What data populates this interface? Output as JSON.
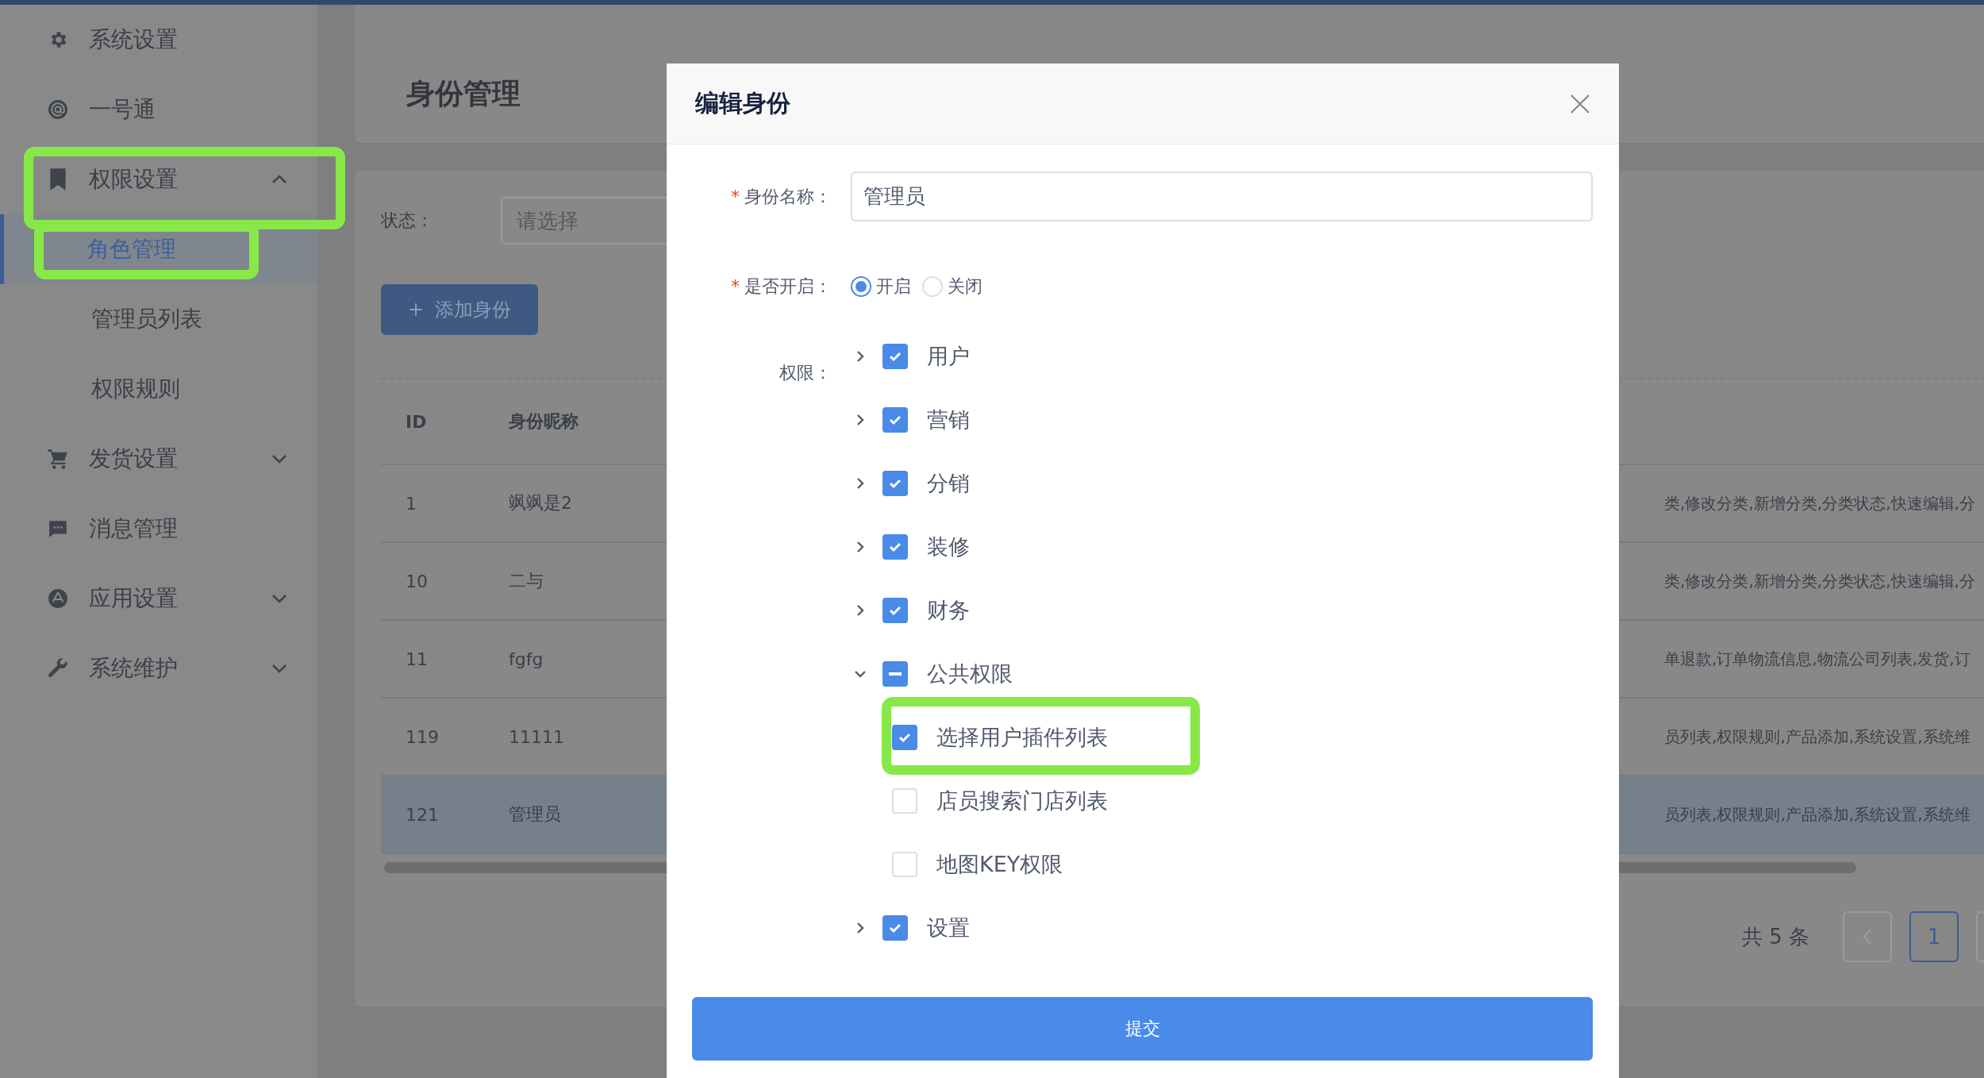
{
  "sidebar": {
    "items": [
      {
        "label": "系统设置"
      },
      {
        "label": "一号通"
      },
      {
        "label": "权限设置",
        "expanded": true,
        "children": [
          {
            "label": "角色管理",
            "selected": true
          },
          {
            "label": "管理员列表",
            "selected": false
          },
          {
            "label": "权限规则",
            "selected": false
          }
        ]
      },
      {
        "label": "发货设置",
        "expanded": false
      },
      {
        "label": "消息管理"
      },
      {
        "label": "应用设置",
        "expanded": false
      },
      {
        "label": "系统维护",
        "expanded": false
      }
    ]
  },
  "page": {
    "title": "身份管理",
    "filter": {
      "label": "状态：",
      "placeholder": "请选择"
    },
    "add_button": {
      "icon": "+",
      "label": "添加身份"
    },
    "table": {
      "columns": [
        "ID",
        "身份昵称"
      ],
      "rows": [
        {
          "id": "1",
          "nickname": "飒飒是2",
          "column_3": "类,修改分类,新增分类,分类状态,快速编辑,分",
          "selected": false
        },
        {
          "id": "10",
          "nickname": "二与",
          "column_3": "类,修改分类,新增分类,分类状态,快速编辑,分",
          "selected": false
        },
        {
          "id": "11",
          "nickname": "fgfg",
          "column_3": "单退款,订单物流信息,物流公司列表,发货,订",
          "selected": false
        },
        {
          "id": "119",
          "nickname": "11111",
          "column_3": "员列表,权限规则,产品添加,系统设置,系统维",
          "selected": false
        },
        {
          "id": "121",
          "nickname": "管理员",
          "column_3": "员列表,权限规则,产品添加,系统设置,系统维",
          "selected": true
        }
      ]
    },
    "pagination": {
      "total": "共 5 条",
      "pages": [
        {
          "label": "1",
          "selected": true
        }
      ]
    }
  },
  "dialog": {
    "title": "编辑身份",
    "name_field": {
      "required_mark": "*",
      "label": "身份名称：",
      "value": "管理员"
    },
    "enabled_field": {
      "required_mark": "*",
      "label": "是否开启：",
      "options": [
        {
          "label": "开启",
          "selected": true
        },
        {
          "label": "关闭",
          "selected": false
        }
      ]
    },
    "permissions": {
      "label": "权限：",
      "tree": [
        {
          "label": "用户",
          "expanded": false,
          "checked": true,
          "indeterminate": false
        },
        {
          "label": "营销",
          "expanded": false,
          "checked": true,
          "indeterminate": false
        },
        {
          "label": "分销",
          "expanded": false,
          "checked": true,
          "indeterminate": false
        },
        {
          "label": "装修",
          "expanded": false,
          "checked": true,
          "indeterminate": false
        },
        {
          "label": "财务",
          "expanded": false,
          "checked": true,
          "indeterminate": false
        },
        {
          "label": "公共权限",
          "expanded": true,
          "indeterminate": true,
          "children": [
            {
              "label": "选择用户插件列表",
              "checked": true
            },
            {
              "label": "店员搜索门店列表",
              "checked": false
            },
            {
              "label": "地图KEY权限",
              "checked": false
            }
          ]
        },
        {
          "label": "设置",
          "expanded": false,
          "checked": true,
          "indeterminate": false
        }
      ]
    },
    "submit": "提交"
  }
}
